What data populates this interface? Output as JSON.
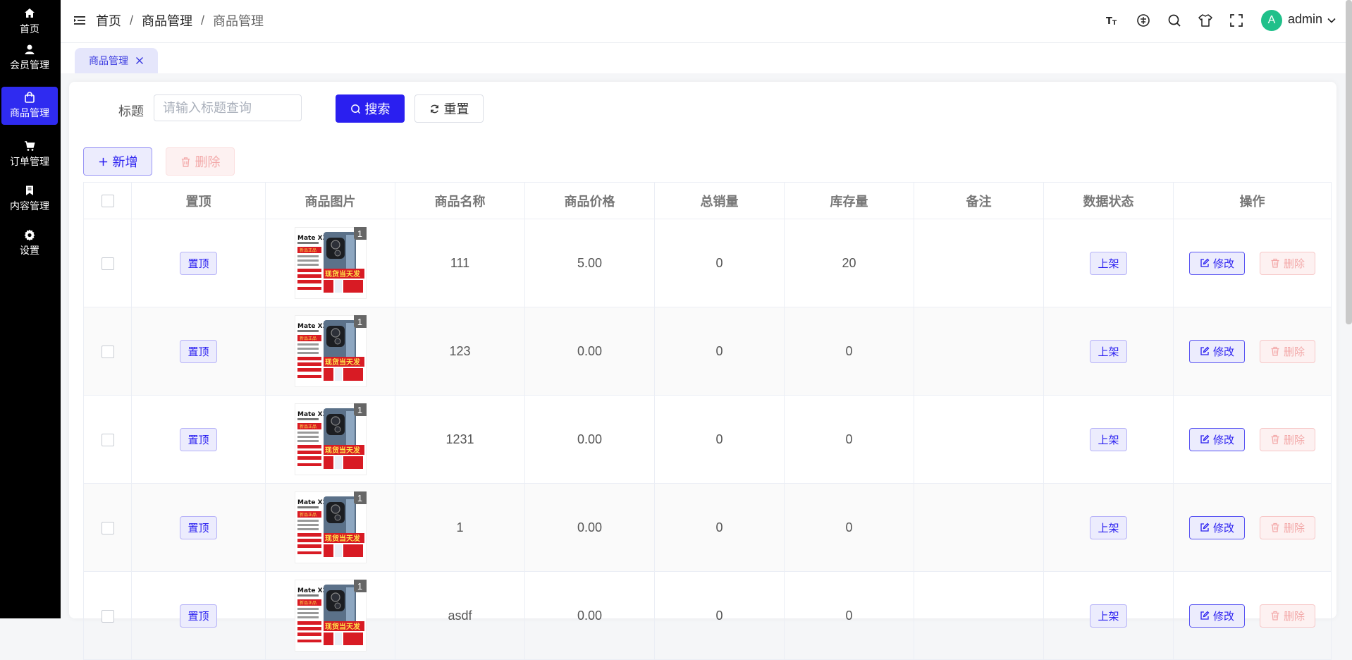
{
  "sidebar": {
    "items": [
      {
        "label": "首页",
        "icon": "home-icon",
        "active": false
      },
      {
        "label": "会员管理",
        "icon": "user-icon",
        "active": false
      },
      {
        "label": "商品管理",
        "icon": "bag-icon",
        "active": true
      },
      {
        "label": "订单管理",
        "icon": "cart-icon",
        "active": false
      },
      {
        "label": "内容管理",
        "icon": "bookmark-icon",
        "active": false
      },
      {
        "label": "设置",
        "icon": "gear-icon",
        "active": false
      }
    ]
  },
  "header": {
    "breadcrumb": [
      "首页",
      "商品管理",
      "商品管理"
    ],
    "separator": "/",
    "tools": [
      "font-size-icon",
      "language-icon",
      "search-icon",
      "theme-icon",
      "fullscreen-icon"
    ],
    "avatar_letter": "A",
    "username": "admin"
  },
  "tabs": [
    {
      "label": "商品管理"
    }
  ],
  "search": {
    "label": "标题",
    "placeholder": "请输入标题查询",
    "search_button": "搜索",
    "reset_button": "重置"
  },
  "actions": {
    "add": "新增",
    "delete": "删除"
  },
  "table": {
    "headers": [
      "置顶",
      "商品图片",
      "商品名称",
      "商品价格",
      "总销量",
      "库存量",
      "备注",
      "数据状态",
      "操作"
    ],
    "rows": [
      {
        "pin": "置顶",
        "image_count": "1",
        "name": "111",
        "price": "5.00",
        "sales": "0",
        "stock": "20",
        "remark": "",
        "status": "上架",
        "edit": "修改",
        "delete": "删除"
      },
      {
        "pin": "置顶",
        "image_count": "1",
        "name": "123",
        "price": "0.00",
        "sales": "0",
        "stock": "0",
        "remark": "",
        "status": "上架",
        "edit": "修改",
        "delete": "删除"
      },
      {
        "pin": "置顶",
        "image_count": "1",
        "name": "1231",
        "price": "0.00",
        "sales": "0",
        "stock": "0",
        "remark": "",
        "status": "上架",
        "edit": "修改",
        "delete": "删除"
      },
      {
        "pin": "置顶",
        "image_count": "1",
        "name": "1",
        "price": "0.00",
        "sales": "0",
        "stock": "0",
        "remark": "",
        "status": "上架",
        "edit": "修改",
        "delete": "删除"
      },
      {
        "pin": "置顶",
        "image_count": "1",
        "name": "asdf",
        "price": "0.00",
        "sales": "0",
        "stock": "0",
        "remark": "",
        "status": "上架",
        "edit": "修改",
        "delete": "删除"
      }
    ]
  },
  "product_image": {
    "title": "Mate X3",
    "banner": "现货当天发",
    "seal": "新品正品"
  },
  "colors": {
    "primary": "#2a1ff0",
    "sidebar": "#000000",
    "avatar": "#20c08a",
    "danger_light": "#f3a9a9"
  }
}
